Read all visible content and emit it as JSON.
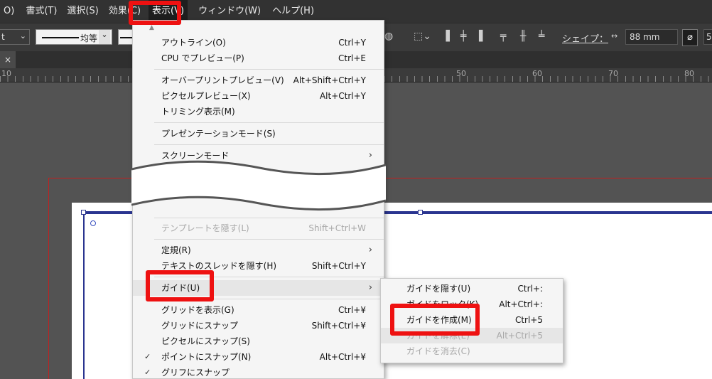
{
  "menubar": {
    "items": [
      {
        "label": "O)"
      },
      {
        "label": "書式(T)"
      },
      {
        "label": "選択(S)"
      },
      {
        "label": "効果(C)"
      },
      {
        "label": "表示(V)"
      },
      {
        "label": "ウィンドウ(W)"
      },
      {
        "label": "ヘルプ(H)"
      }
    ]
  },
  "controlbar": {
    "stroke_style_label": "均等",
    "shape_label": "シェイプ：",
    "width_value": "88 mm",
    "partial_value": "5"
  },
  "tab": {
    "close_label": "×"
  },
  "ruler": {
    "labels": [
      "10",
      "50",
      "60",
      "70",
      "80"
    ]
  },
  "view_menu": {
    "items": [
      {
        "label": "アウトライン(O)",
        "shortcut": "Ctrl+Y"
      },
      {
        "label": "CPU でプレビュー(P)",
        "shortcut": "Ctrl+E"
      },
      {
        "label": "オーバープリントプレビュー(V)",
        "shortcut": "Alt+Shift+Ctrl+Y"
      },
      {
        "label": "ピクセルプレビュー(X)",
        "shortcut": "Alt+Ctrl+Y"
      },
      {
        "label": "トリミング表示(M)",
        "shortcut": ""
      },
      {
        "label": "プレゼンテーションモード(S)",
        "shortcut": ""
      },
      {
        "label": "スクリーンモード",
        "shortcut": ""
      },
      {
        "label": "テンプレートを隠す(L)",
        "shortcut": "Shift+Ctrl+W"
      },
      {
        "label": "定規(R)",
        "shortcut": ""
      },
      {
        "label": "テキストのスレッドを隠す(H)",
        "shortcut": "Shift+Ctrl+Y"
      },
      {
        "label": "ガイド(U)",
        "shortcut": ""
      },
      {
        "label": "グリッドを表示(G)",
        "shortcut": "Ctrl+¥"
      },
      {
        "label": "グリッドにスナップ",
        "shortcut": "Shift+Ctrl+¥"
      },
      {
        "label": "ピクセルにスナップ(S)",
        "shortcut": ""
      },
      {
        "label": "ポイントにスナップ(N)",
        "shortcut": "Alt+Ctrl+¥"
      },
      {
        "label": "グリフにスナップ",
        "shortcut": ""
      }
    ]
  },
  "guide_submenu": {
    "items": [
      {
        "label": "ガイドを隠す(U)",
        "shortcut": "Ctrl+:"
      },
      {
        "label": "ガイドをロック(K)",
        "shortcut": "Alt+Ctrl+:"
      },
      {
        "label": "ガイドを作成(M)",
        "shortcut": "Ctrl+5"
      },
      {
        "label": "ガイドを解除(E)",
        "shortcut": "Alt+Ctrl+5"
      },
      {
        "label": "ガイドを消去(C)",
        "shortcut": ""
      }
    ]
  },
  "colors": {
    "callout": "#ee1111",
    "menubar_bg": "#323232",
    "menu_bg": "#f5f5f5",
    "selection_blue": "#2a3590"
  }
}
